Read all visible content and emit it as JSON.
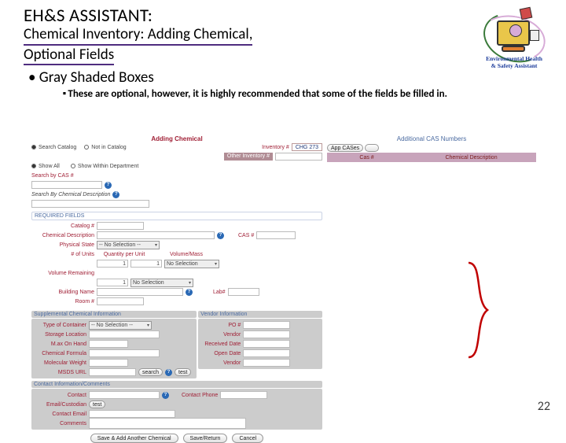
{
  "header": {
    "title1": "EH&S ASSISTANT:",
    "title2": "Chemical Inventory: Adding Chemical,",
    "title3": "Optional Fields"
  },
  "bullets": {
    "b1": "Gray Shaded Boxes",
    "b2": "These are optional, however, it is highly recommended that some of the fields be filled in."
  },
  "logo": {
    "line1": "Environmental Health",
    "line2": "& Safety Assistant",
    "icon_name": "ehs-assistant-mascot-icon"
  },
  "page_number": "22",
  "screenshot": {
    "left": {
      "adding_title_prefix": "Adding",
      "adding_title": " Chemical",
      "search_catalog": "Search Catalog",
      "not_in_catalog": "Not in Catalog",
      "inventory_no_lbl": "Inventory #",
      "inventory_no_val": "CHG  273",
      "other_inv_lbl": "Other Inventory #",
      "show_all": "Show All",
      "show_within": "Show Within Department",
      "search_cas": "Search by CAS #",
      "search_by_desc": "Search By Chemical Description",
      "required_heading": "REQUIRED FIELDS",
      "catalog_no": "Catalog #",
      "chem_desc": "Chemical Description",
      "cas_lbl": "CAS #",
      "physical_state": "Physical State",
      "no_selection": "-- No Selection --",
      "num_units": "# of Units",
      "qty_unit": "Quantity per Unit",
      "vol_mass": "Volume/Mass",
      "one": "1",
      "vol_remaining": "Volume Remaining",
      "no_selection2": "No Selection",
      "building_name": "Building Name",
      "lab": "Lab#",
      "room_no": "Room #",
      "supp_heading": "Supplemental Chemical Information",
      "vendor_heading": "Vendor Information",
      "type_container": "Type of Container",
      "po_no": "PO #",
      "storage_loc": "Storage Location",
      "vendor": "Vendor",
      "max_on_hand": "M.ax On Hand",
      "received_date": "Received Date",
      "chem_formula": "Chemical Formula",
      "open_date": "Open Date",
      "mol_weight": "Molecular Weight",
      "msds_url": "MSDS URL",
      "search": "search",
      "test": "test",
      "contact_heading": "Contact Information/Comments",
      "contact": "Contact",
      "contact_phone": "Contact Phone",
      "email_custodian": "Email/Custodian",
      "contact_email": "Contact Email",
      "comments": "Comments",
      "btn_save_add": "Save & Add Another Chemical",
      "btn_save_return": "Save/Return",
      "btn_cancel": "Cancel"
    },
    "right": {
      "acn_title": "Additional CAS Numbers",
      "btn_appcas": "App CASes",
      "btn_blank": " ",
      "th_cas": "Cas #",
      "th_desc": "Chemical Description"
    }
  }
}
